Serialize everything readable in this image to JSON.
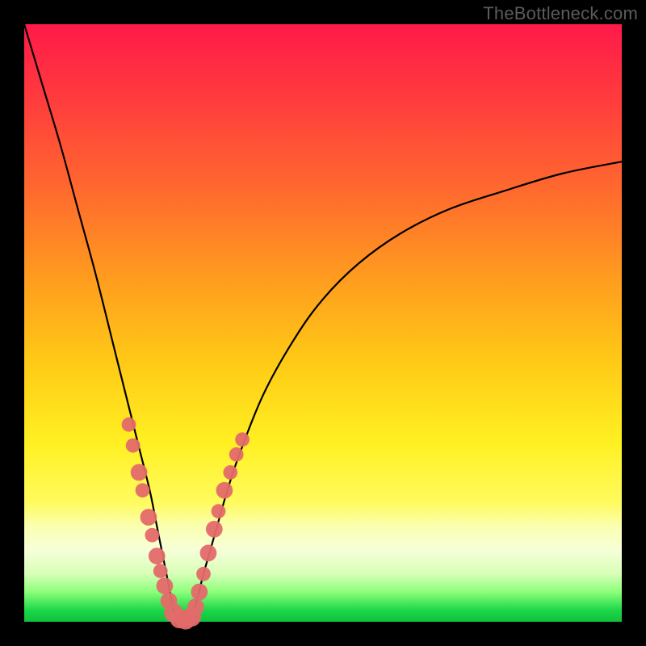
{
  "watermark": "TheBottleneck.com",
  "colors": {
    "frame": "#000000",
    "gradient_top": "#ff1a49",
    "gradient_bottom": "#0fbf3c",
    "curve": "#000000",
    "marker": "#e46a6a"
  },
  "chart_data": {
    "type": "line",
    "title": "",
    "xlabel": "",
    "ylabel": "",
    "xlim": [
      0,
      100
    ],
    "ylim": [
      0,
      100
    ],
    "grid": false,
    "legend": false,
    "description": "V-shaped bottleneck curve. Left branch descends steeply from top-left corner (x≈0, y≈100) to a minimum near x≈25, y≈0. Right branch rises with decreasing slope toward the upper-right, ending near x≈100, y≈77.",
    "series": [
      {
        "name": "left-branch",
        "x": [
          0,
          3,
          6,
          9,
          12,
          15,
          17,
          19,
          21,
          22,
          23,
          24,
          25,
          26,
          27
        ],
        "y": [
          100,
          90,
          80,
          69,
          58,
          46,
          38,
          30,
          22,
          17,
          12,
          7,
          2,
          0,
          0
        ]
      },
      {
        "name": "right-branch",
        "x": [
          27,
          28,
          29,
          30,
          32,
          34,
          36,
          40,
          45,
          50,
          56,
          63,
          71,
          80,
          90,
          100
        ],
        "y": [
          0,
          1,
          4,
          8,
          15,
          22,
          28,
          38,
          47,
          54,
          60,
          65,
          69,
          72,
          75,
          77
        ]
      }
    ],
    "markers": [
      {
        "x": 17.5,
        "y": 33.0,
        "r": 1.2
      },
      {
        "x": 18.2,
        "y": 29.5,
        "r": 1.2
      },
      {
        "x": 19.2,
        "y": 25.0,
        "r": 1.4
      },
      {
        "x": 19.8,
        "y": 22.0,
        "r": 1.2
      },
      {
        "x": 20.8,
        "y": 17.5,
        "r": 1.4
      },
      {
        "x": 21.4,
        "y": 14.5,
        "r": 1.2
      },
      {
        "x": 22.2,
        "y": 11.0,
        "r": 1.4
      },
      {
        "x": 22.8,
        "y": 8.5,
        "r": 1.2
      },
      {
        "x": 23.5,
        "y": 6.0,
        "r": 1.4
      },
      {
        "x": 24.2,
        "y": 3.5,
        "r": 1.4
      },
      {
        "x": 25.0,
        "y": 1.5,
        "r": 1.6
      },
      {
        "x": 26.0,
        "y": 0.5,
        "r": 1.6
      },
      {
        "x": 27.0,
        "y": 0.3,
        "r": 1.6
      },
      {
        "x": 28.0,
        "y": 0.8,
        "r": 1.6
      },
      {
        "x": 28.7,
        "y": 2.5,
        "r": 1.4
      },
      {
        "x": 29.3,
        "y": 5.0,
        "r": 1.4
      },
      {
        "x": 30.0,
        "y": 8.0,
        "r": 1.2
      },
      {
        "x": 30.8,
        "y": 11.5,
        "r": 1.4
      },
      {
        "x": 31.8,
        "y": 15.5,
        "r": 1.4
      },
      {
        "x": 32.5,
        "y": 18.5,
        "r": 1.2
      },
      {
        "x": 33.5,
        "y": 22.0,
        "r": 1.4
      },
      {
        "x": 34.5,
        "y": 25.0,
        "r": 1.2
      },
      {
        "x": 35.5,
        "y": 28.0,
        "r": 1.2
      },
      {
        "x": 36.5,
        "y": 30.5,
        "r": 1.2
      }
    ]
  }
}
